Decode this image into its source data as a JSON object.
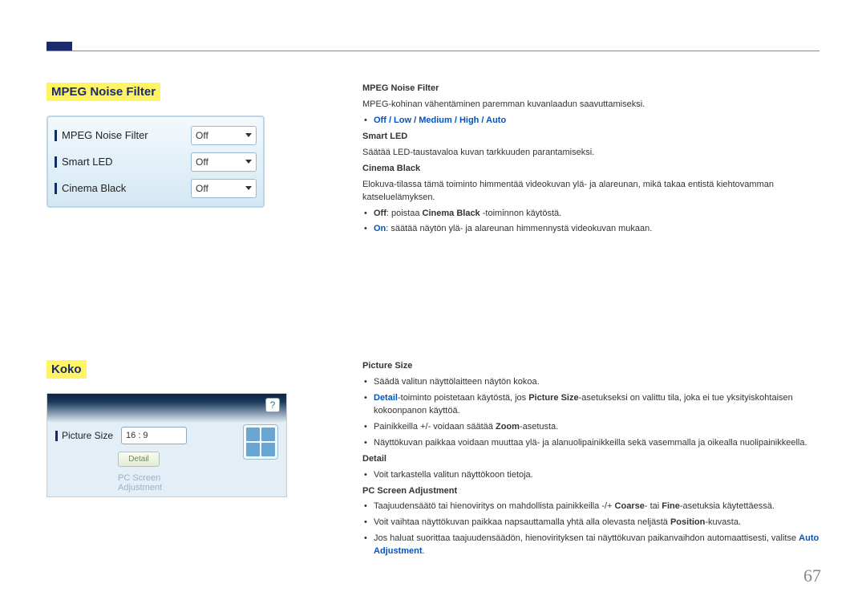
{
  "page_number": "67",
  "section1": {
    "heading": "MPEG Noise Filter",
    "panel": {
      "rows": [
        {
          "label": "MPEG Noise Filter",
          "value": "Off"
        },
        {
          "label": "Smart LED",
          "value": "Off"
        },
        {
          "label": "Cinema Black",
          "value": "Off"
        }
      ]
    },
    "desc": {
      "h_mpeg": "MPEG Noise Filter",
      "p_mpeg": "MPEG-kohinan vähentäminen paremman kuvanlaadun saavuttamiseksi.",
      "opts": "Off / Low / Medium / High / Auto",
      "h_smart": "Smart LED",
      "p_smart": "Säätää LED-taustavaloa kuvan tarkkuuden parantamiseksi.",
      "h_cinema": "Cinema Black",
      "p_cinema": "Elokuva-tilassa tämä toiminto himmentää videokuvan ylä- ja alareunan, mikä takaa entistä kiehtovamman katseluelämyksen.",
      "off_pre": "Off",
      "off_mid": ": poistaa ",
      "off_b": "Cinema Black",
      "off_post": " -toiminnon käytöstä.",
      "on_pre": "On",
      "on_post": ": säätää näytön ylä- ja alareunan himmennystä videokuvan mukaan."
    }
  },
  "section2": {
    "heading": "Koko",
    "panel": {
      "help": "?",
      "psize_label": "Picture Size",
      "psize_value": "16 : 9",
      "detail_btn": "Detail",
      "pc_adjust1": "PC Screen",
      "pc_adjust2": "Adjustment"
    },
    "desc": {
      "h_psize": "Picture Size",
      "b1": "Säädä valitun näyttölaitteen näytön kokoa.",
      "b2_pre": "Detail",
      "b2_mid1": "-toiminto poistetaan käytöstä, jos ",
      "b2_mid2": "Picture Size",
      "b2_post": "-asetukseksi on valittu tila, joka ei tue yksityiskohtaisen kokoonpanon käyttöä.",
      "b3_pre": "Painikkeilla +/- voidaan säätää ",
      "b3_zoom": "Zoom",
      "b3_post": "-asetusta.",
      "b4": "Näyttökuvan paikkaa voidaan muuttaa ylä- ja alanuolipainikkeilla sekä vasemmalla ja oikealla nuolipainikkeella.",
      "h_detail": "Detail",
      "d1": "Voit tarkastella valitun näyttökoon tietoja.",
      "h_pcadj": "PC Screen Adjustment",
      "p1_pre": "Taajuudensäätö tai hienoviritys on mahdollista painikkeilla -/+ ",
      "p1_c": "Coarse",
      "p1_mid": "- tai ",
      "p1_f": "Fine",
      "p1_post": "-asetuksia käytettäessä.",
      "p2_pre": "Voit vaihtaa näyttökuvan paikkaa napsauttamalla yhtä alla olevasta neljästä ",
      "p2_pos": "Position",
      "p2_post": "-kuvasta.",
      "p3_pre": "Jos haluat suorittaa taajuudensäädön, hienovirityksen tai näyttökuvan paikanvaihdon automaattisesti, valitse ",
      "p3_auto": "Auto Adjustment",
      "p3_post": "."
    }
  }
}
